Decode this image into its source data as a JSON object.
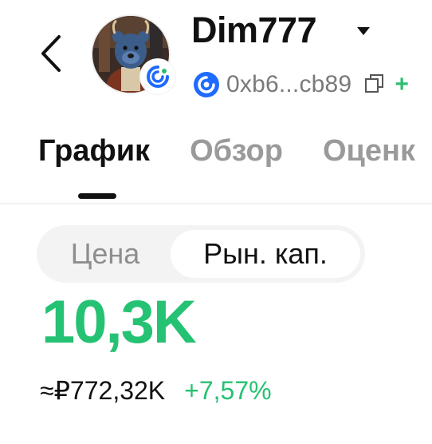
{
  "header": {
    "title": "Dim777",
    "address": "0xb6...cb89",
    "more_partial": "+"
  },
  "tabs": [
    {
      "label": "График",
      "active": true
    },
    {
      "label": "Обзор",
      "active": false
    },
    {
      "label": "Оценк",
      "active": false
    }
  ],
  "segment": {
    "options": [
      "Цена",
      "Рын. кап."
    ],
    "selected": "Рын. кап."
  },
  "metrics": {
    "market_cap": "10,3K",
    "fiat_value": "≈₽772,32K",
    "change": "+7,57%"
  },
  "colors": {
    "positive": "#25c273",
    "chain_blue": "#1f6bff",
    "text_primary": "#111111",
    "text_secondary": "#7a7a7a"
  },
  "icons": {
    "back": "chevron-left-icon",
    "dropdown": "caret-down-icon",
    "chain": "chain-logo-icon",
    "copy": "copy-icon"
  }
}
